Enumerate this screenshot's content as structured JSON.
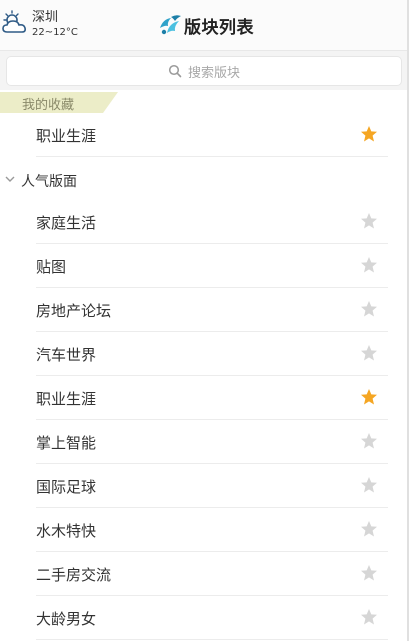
{
  "header": {
    "city": "深圳",
    "temperature": "22~12°C",
    "title": "版块列表",
    "weather_icon": "partly-cloudy-icon",
    "logo_icon": "shuimu-logo-icon"
  },
  "search": {
    "placeholder": "搜索版块"
  },
  "favorites": {
    "label": "我的收藏",
    "items": [
      {
        "label": "职业生涯",
        "starred": true
      }
    ]
  },
  "popular": {
    "label": "人气版面",
    "expanded": true,
    "items": [
      {
        "label": "家庭生活",
        "starred": false
      },
      {
        "label": "贴图",
        "starred": false
      },
      {
        "label": "房地产论坛",
        "starred": false
      },
      {
        "label": "汽车世界",
        "starred": false
      },
      {
        "label": "职业生涯",
        "starred": true
      },
      {
        "label": "掌上智能",
        "starred": false
      },
      {
        "label": "国际足球",
        "starred": false
      },
      {
        "label": "水木特快",
        "starred": false
      },
      {
        "label": "二手房交流",
        "starred": false
      },
      {
        "label": "大龄男女",
        "starred": false
      }
    ]
  },
  "colors": {
    "star_on": "#f5a623",
    "star_off": "#d6d6d6",
    "tag_bg": "#ecedc8"
  }
}
